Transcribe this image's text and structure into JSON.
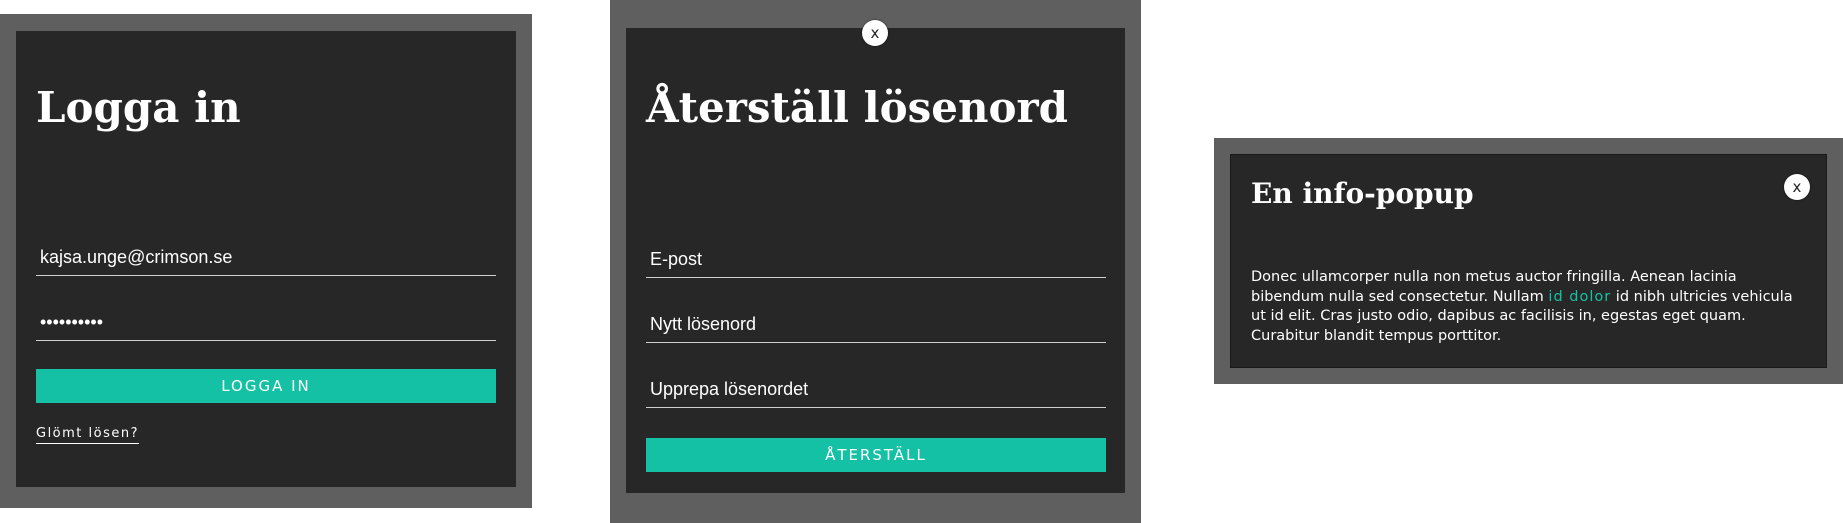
{
  "login": {
    "title": "Logga in",
    "email_value": "kajsa.unge@crimson.se",
    "password_value": "xxxxxxxxxx",
    "submit_label": "LOGGA IN",
    "forgot_link": "Glömt lösen?"
  },
  "reset": {
    "close_label": "x",
    "title": "Återställ lösenord",
    "email_placeholder": "E-post",
    "new_password_placeholder": "Nytt lösenord",
    "repeat_password_placeholder": "Upprepa lösenordet",
    "submit_label": "ÅTERSTÄLL"
  },
  "info": {
    "title": "En info-popup",
    "close_label": "x",
    "text_before": "Donec ullamcorper nulla non metus auctor fringilla. Aenean lacinia bibendum nulla sed consectetur. Nullam ",
    "link_text": "id dolor",
    "text_after": " id nibh ultricies vehicula ut id elit. Cras justo odio, dapibus ac facilisis in, egestas eget quam. Curabitur blandit tempus porttitor."
  },
  "colors": {
    "accent": "#14c1a4",
    "panel": "#272727",
    "frame": "#5f5f5f"
  }
}
